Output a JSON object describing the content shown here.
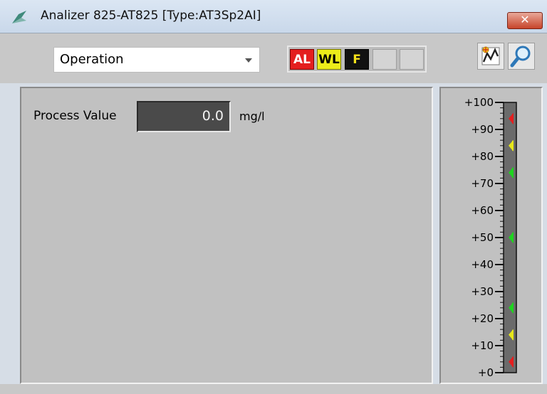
{
  "window": {
    "title": "Analizer 825-AT825  [Type:AT3Sp2AI]",
    "close_label": "✕"
  },
  "toolbar": {
    "mode_select": {
      "selected": "Operation"
    },
    "badges": [
      {
        "label": "AL",
        "color": "#e41f1f"
      },
      {
        "label": "WL",
        "color": "#ecec1a"
      },
      {
        "label": "F",
        "color": "#111111"
      },
      {
        "label": ""
      },
      {
        "label": ""
      }
    ],
    "trend_button_icon": "trend-icon",
    "zoom_button_icon": "magnifier-icon"
  },
  "process": {
    "label": "Process Value",
    "value": "0.0",
    "unit": "mg/l"
  },
  "scale": {
    "min": 0,
    "max": 100,
    "tick_labels": [
      "+100",
      "+90",
      "+80",
      "+70",
      "+60",
      "+50",
      "+40",
      "+30",
      "+20",
      "+10",
      "+0"
    ],
    "markers": [
      {
        "value": 94,
        "color": "#e41f1f",
        "kind": "high-alarm"
      },
      {
        "value": 84,
        "color": "#e6e61a",
        "kind": "high-warning"
      },
      {
        "value": 74,
        "color": "#1fd41f",
        "kind": "high-limit"
      },
      {
        "value": 50,
        "color": "#1fd41f",
        "kind": "setpoint"
      },
      {
        "value": 24,
        "color": "#1fd41f",
        "kind": "low-limit"
      },
      {
        "value": 14,
        "color": "#e6e61a",
        "kind": "low-warning"
      },
      {
        "value": 4,
        "color": "#e41f1f",
        "kind": "low-alarm"
      }
    ]
  }
}
